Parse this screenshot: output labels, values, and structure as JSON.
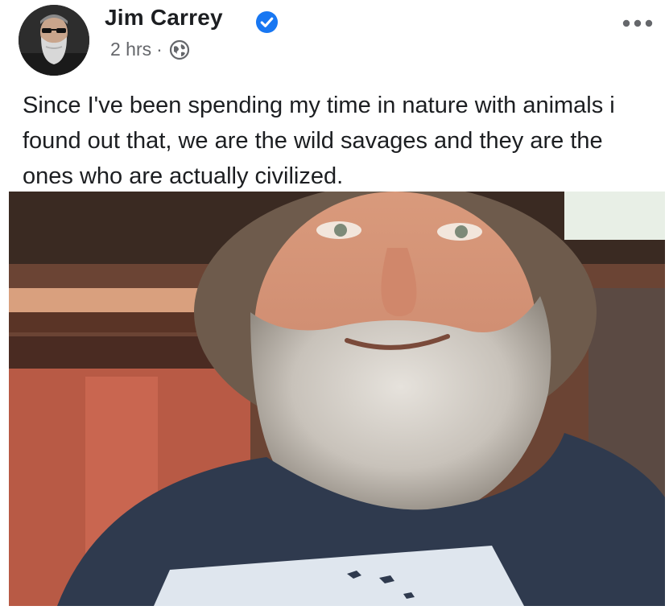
{
  "post": {
    "author": "Jim Carrey",
    "timestamp": "2 hrs",
    "separator": "·",
    "text": "Since I've been spending my time in nature with animals i found out that, we are the wild savages and they are the ones who are actually civilized.",
    "audience_icon": "globe-icon",
    "verified_icon": "verified-badge-icon",
    "more_icon": "more-options-icon"
  },
  "colors": {
    "text": "#1c1e21",
    "meta": "#65676b",
    "verified": "#1877f2"
  }
}
